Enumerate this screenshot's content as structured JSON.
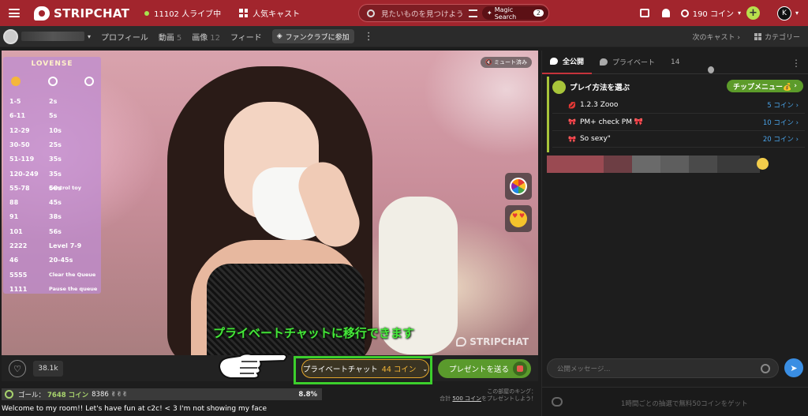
{
  "topbar": {
    "logo": "STRIPCHAT",
    "live_count": "11102 人ライブ中",
    "popular": "人気キャスト",
    "search_placeholder": "見たいものを見つけよう",
    "magic_search": "Magic Search",
    "magic_count": "2",
    "coins": "190 コイン",
    "avatar_letter": "K"
  },
  "subbar": {
    "profile": "プロフィール",
    "videos": "動画",
    "videos_count": "5",
    "images": "画像",
    "images_count": "12",
    "feed": "フィード",
    "fanclub": "ファンクラブに参加",
    "next_cast": "次のキャスト",
    "category": "カテゴリー"
  },
  "lovense": {
    "title": "LOVENSE",
    "rows": [
      {
        "a": "1-5",
        "b": "2s"
      },
      {
        "a": "6-11",
        "b": "5s"
      },
      {
        "a": "12-29",
        "b": "10s"
      },
      {
        "a": "30-50",
        "b": "25s"
      },
      {
        "a": "51-119",
        "b": "35s"
      },
      {
        "a": "120-249",
        "b": "35s"
      },
      {
        "a": "55-78",
        "b": "50s",
        "d": "Control toy"
      },
      {
        "a": "88",
        "b": "45s"
      },
      {
        "a": "91",
        "b": "38s"
      },
      {
        "a": "101",
        "b": "56s"
      },
      {
        "a": "2222",
        "b": "Level 7-9"
      },
      {
        "a": "46",
        "b": "20-45s"
      },
      {
        "a": "5555",
        "d": "Clear the Queue"
      },
      {
        "a": "1111",
        "d": "Pause the queue"
      }
    ]
  },
  "video": {
    "mute": "ミュート済み",
    "overlay_text": "プライベートチャットに移行できます",
    "watermark": "STRIPCHAT"
  },
  "controls": {
    "likes": "38.1k",
    "private_label": "プライベートチャット",
    "private_price": "44 コイン",
    "gift_label": "プレゼントを送る"
  },
  "goal": {
    "label": "ゴール：",
    "target": "7648 コイン",
    "current": "8386 ✌✌✌",
    "percent": "8.8%"
  },
  "king": {
    "line1": "この部屋のキング：",
    "line2_prefix": "合計",
    "line2_amount": "500 コイン",
    "line2_suffix": "をプレゼントしよう！"
  },
  "welcome": "Welcome to my room!! Let's have fun at c2c! < 3 I'm not showing my face",
  "chat": {
    "tab_public": "全公開",
    "tab_private": "プライベート",
    "viewers": "14",
    "tip_menu_title": "プレイ方法を選ぶ",
    "tip_menu_button": "チップメニュー💰",
    "tip_items": [
      {
        "icon": "💋",
        "name": "1.2.3 Zooo",
        "price": "5 コイン"
      },
      {
        "icon": "🎀",
        "name": "PM+ check PM 🎀",
        "price": "10 コイン"
      },
      {
        "icon": "🎀",
        "name": "So sexy\"",
        "price": "20 コイン"
      }
    ],
    "input_placeholder": "公開メッセージ...",
    "free_text": "1時間ごとの抽選で無料50コインをゲット"
  }
}
